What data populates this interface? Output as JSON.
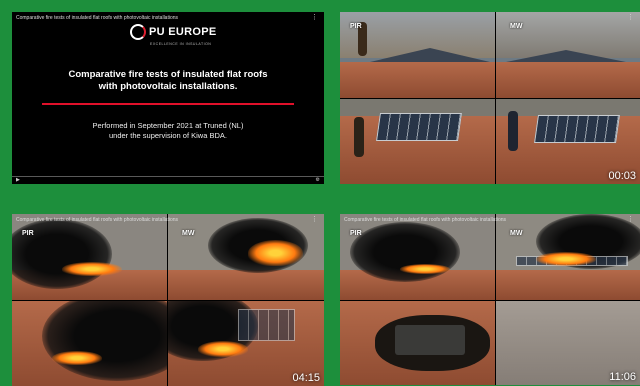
{
  "tiles": [
    {
      "caption": "Comparative fire tests of insulated flat roofs with photovoltaic installations",
      "logo": "PU EUROPE",
      "logo_tagline": "EXCELLENCE IN INSULATION",
      "title_line1": "Comparative fire tests of insulated flat roofs",
      "title_line2": "with photovoltaic installations.",
      "subtitle_line1": "Performed in September 2021 at Truned (NL)",
      "subtitle_line2": "under the supervision of Kiwa BDA."
    },
    {
      "label_left": "PIR",
      "label_right": "MW",
      "timestamp": "00:03"
    },
    {
      "caption": "Comparative fire tests of insulated flat roofs with photovoltaic installations",
      "label_left": "PIR",
      "label_right": "MW",
      "timestamp": "04:15"
    },
    {
      "caption": "Comparative fire tests of insulated flat roofs with photovoltaic installations",
      "label_left": "PIR",
      "label_right": "MW",
      "timestamp": "11:06"
    }
  ],
  "icons": {
    "menu": "⋮",
    "play": "▶",
    "settings": "⚙"
  }
}
